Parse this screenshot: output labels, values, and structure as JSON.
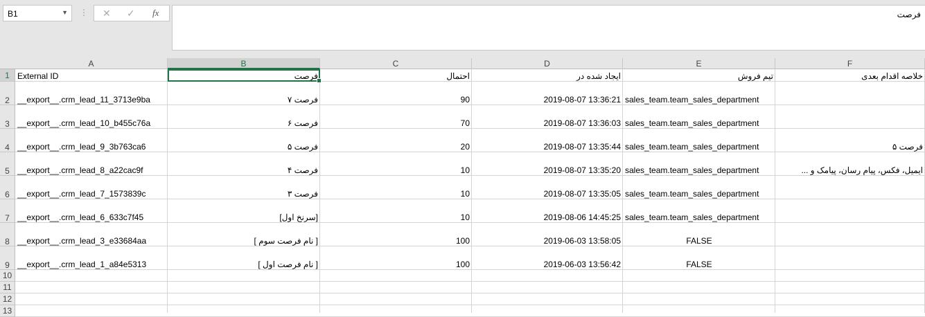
{
  "toolbar": {
    "name_box": "B1",
    "formula": "فرصت",
    "cancel_icon": "x-icon",
    "enter_icon": "check-icon",
    "fx_label": "fx"
  },
  "columns": [
    "A",
    "B",
    "C",
    "D",
    "E",
    "F"
  ],
  "selected": {
    "column": "B",
    "row": "1"
  },
  "rows": [
    "1",
    "2",
    "3",
    "4",
    "5",
    "6",
    "7",
    "8",
    "9",
    "10",
    "11",
    "12",
    "13"
  ],
  "headers": {
    "A": "External ID",
    "B": "فرصت",
    "C": "احتمال",
    "D": "ایجاد شده در",
    "E": "تیم فروش",
    "F": "خلاصه اقدام بعدی"
  },
  "records": [
    {
      "A": "__export__.crm_lead_11_3713e9ba",
      "B": "فرصت ۷",
      "C": "90",
      "D": "2019-08-07 13:36:21",
      "E": "sales_team.team_sales_department",
      "F": ""
    },
    {
      "A": "__export__.crm_lead_10_b455c76a",
      "B": "فرصت ۶",
      "C": "70",
      "D": "2019-08-07 13:36:03",
      "E": "sales_team.team_sales_department",
      "F": ""
    },
    {
      "A": "__export__.crm_lead_9_3b763ca6",
      "B": "فرصت ۵",
      "C": "20",
      "D": "2019-08-07 13:35:44",
      "E": "sales_team.team_sales_department",
      "F": "فرصت ۵"
    },
    {
      "A": "__export__.crm_lead_8_a22cac9f",
      "B": "فرصت ۴",
      "C": "10",
      "D": "2019-08-07 13:35:20",
      "E": "sales_team.team_sales_department",
      "F": "ایمیل، فکس، پیام رسان، پیامک و ..."
    },
    {
      "A": "__export__.crm_lead_7_1573839c",
      "B": "فرصت ۳",
      "C": "10",
      "D": "2019-08-07 13:35:05",
      "E": "sales_team.team_sales_department",
      "F": ""
    },
    {
      "A": "__export__.crm_lead_6_633c7f45",
      "B": "[سرنخ اول]",
      "C": "10",
      "D": "2019-08-06 14:45:25",
      "E": "sales_team.team_sales_department",
      "F": ""
    },
    {
      "A": "__export__.crm_lead_3_e33684aa",
      "B": "[ نام فرصت سوم ]",
      "C": "100",
      "D": "2019-06-03 13:58:05",
      "E": "FALSE",
      "F": ""
    },
    {
      "A": "__export__.crm_lead_1_a84e5313",
      "B": "[ نام فرصت اول ]",
      "C": "100",
      "D": "2019-06-03 13:56:42",
      "E": "FALSE",
      "F": ""
    }
  ]
}
